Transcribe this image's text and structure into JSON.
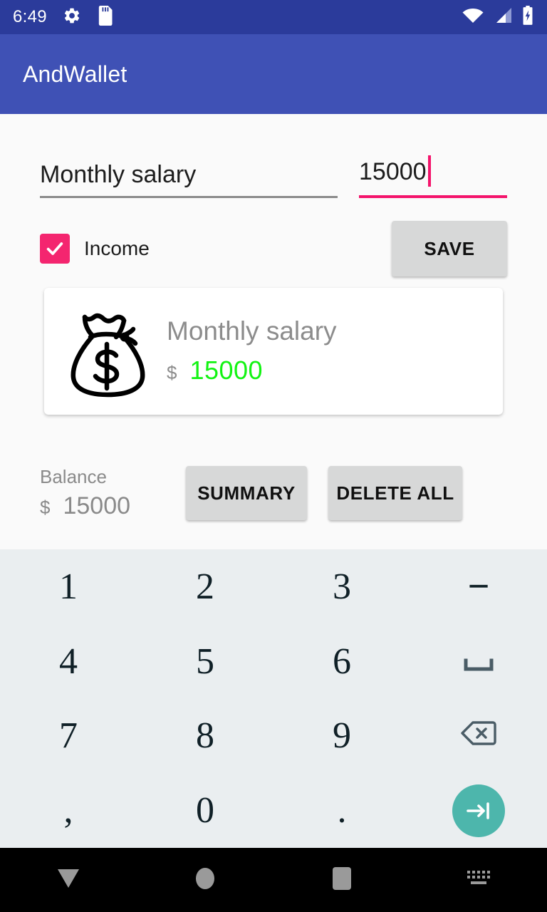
{
  "status_bar": {
    "time": "6:49",
    "icons_left": [
      "gear-icon",
      "sd-card-icon"
    ],
    "icons_right": [
      "wifi-icon",
      "cell-signal-icon",
      "battery-charging-icon"
    ],
    "background": "#2b3b9b"
  },
  "app_bar": {
    "title": "AndWallet",
    "background": "#3f51b5"
  },
  "form": {
    "description_field": {
      "value": "Monthly salary",
      "placeholder": "Description",
      "underline_color": "#8a8a8a"
    },
    "amount_field": {
      "value": "15000",
      "placeholder": "Amount",
      "underline_color": "#f4136b",
      "focused": true
    },
    "income_checkbox": {
      "label": "Income",
      "checked": true,
      "color": "#f4256f"
    },
    "save_button": {
      "label": "SAVE"
    }
  },
  "transaction_card": {
    "icon": "money-bag-icon",
    "title": "Monthly salary",
    "currency": "$",
    "amount": "15000",
    "amount_color": "#12f312"
  },
  "balance": {
    "label": "Balance",
    "currency": "$",
    "value": "15000",
    "summary_button": "SUMMARY",
    "delete_all_button": "DELETE ALL"
  },
  "keyboard": {
    "keys": [
      {
        "label": "1",
        "name": "key-1"
      },
      {
        "label": "2",
        "name": "key-2"
      },
      {
        "label": "3",
        "name": "key-3"
      },
      {
        "label": "−",
        "name": "key-minus"
      },
      {
        "label": "4",
        "name": "key-4"
      },
      {
        "label": "5",
        "name": "key-5"
      },
      {
        "label": "6",
        "name": "key-6"
      },
      {
        "label": "",
        "name": "key-space"
      },
      {
        "label": "7",
        "name": "key-7"
      },
      {
        "label": "8",
        "name": "key-8"
      },
      {
        "label": "9",
        "name": "key-9"
      },
      {
        "label": "",
        "name": "key-backspace"
      },
      {
        "label": ",",
        "name": "key-comma"
      },
      {
        "label": "0",
        "name": "key-0"
      },
      {
        "label": ".",
        "name": "key-period"
      },
      {
        "label": "",
        "name": "key-next"
      }
    ],
    "accent": "#4db6ac",
    "background": "#eaeef0"
  },
  "nav_bar": {
    "back": "down-chevron-icon",
    "home": "circle-home-icon",
    "recents": "square-recents-icon",
    "keyboard_switch": "keyboard-icon"
  }
}
